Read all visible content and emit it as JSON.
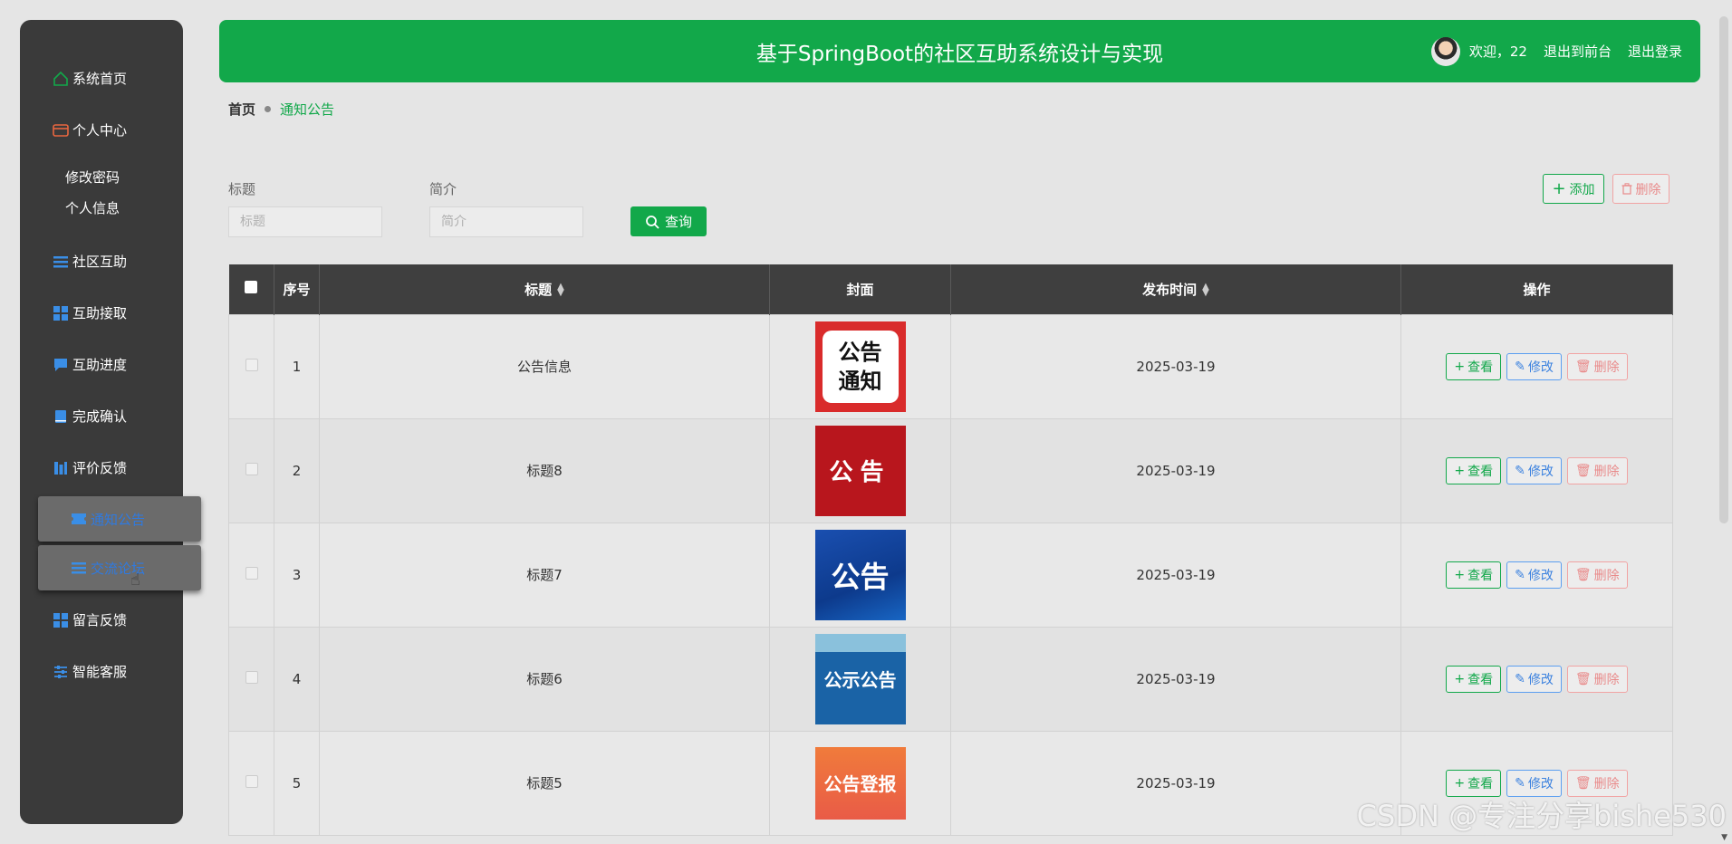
{
  "header": {
    "title": "基于SpringBoot的社区互助系统设计与实现",
    "welcome": "欢迎，22",
    "to_front": "退出到前台",
    "logout": "退出登录"
  },
  "sidebar": {
    "items": [
      {
        "label": "系统首页",
        "icon": "home-icon",
        "color": "#12a84a"
      },
      {
        "label": "个人中心",
        "icon": "wallet-icon",
        "color": "#e8663f"
      },
      {
        "label": "社区互助",
        "icon": "list-icon",
        "color": "#3a8ee6"
      },
      {
        "label": "互助接取",
        "icon": "grid-icon",
        "color": "#3a8ee6"
      },
      {
        "label": "互助进度",
        "icon": "chat-icon",
        "color": "#3a8ee6"
      },
      {
        "label": "完成确认",
        "icon": "book-icon",
        "color": "#3a8ee6"
      },
      {
        "label": "评价反馈",
        "icon": "bars-icon",
        "color": "#3a8ee6"
      },
      {
        "label": "通知公告",
        "icon": "ticket-icon",
        "color": "#3a8ee6"
      },
      {
        "label": "交流论坛",
        "icon": "list-icon",
        "color": "#3a8ee6"
      },
      {
        "label": "留言反馈",
        "icon": "grid-icon",
        "color": "#3a8ee6"
      },
      {
        "label": "智能客服",
        "icon": "sliders-icon",
        "color": "#3a8ee6"
      }
    ],
    "sub_items": [
      "修改密码",
      "个人信息"
    ]
  },
  "breadcrumb": {
    "home": "首页",
    "current": "通知公告"
  },
  "search": {
    "title_label": "标题",
    "title_placeholder": "标题",
    "intro_label": "简介",
    "intro_placeholder": "简介",
    "query_label": "查询"
  },
  "actions": {
    "add": "添加",
    "delete": "删除"
  },
  "table": {
    "headers": {
      "index": "序号",
      "title": "标题",
      "cover": "封面",
      "time": "发布时间",
      "ops": "操作"
    },
    "rows": [
      {
        "index": "1",
        "title": "公告信息",
        "time": "2025-03-19",
        "cover_text": "公告通知"
      },
      {
        "index": "2",
        "title": "标题8",
        "time": "2025-03-19",
        "cover_text": "公告"
      },
      {
        "index": "3",
        "title": "标题7",
        "time": "2025-03-19",
        "cover_text": "公告"
      },
      {
        "index": "4",
        "title": "标题6",
        "time": "2025-03-19",
        "cover_text": "公示公告"
      },
      {
        "index": "5",
        "title": "标题5",
        "time": "2025-03-19",
        "cover_text": "公告登报"
      }
    ],
    "ops": {
      "view": "查看",
      "edit": "修改",
      "delete": "删除"
    }
  },
  "watermark": "CSDN @专注分享bishe530",
  "colors": {
    "accent": "#12a84a",
    "sidebar_bg": "#3a3a3a",
    "header_row_bg": "#3f3f3f"
  }
}
